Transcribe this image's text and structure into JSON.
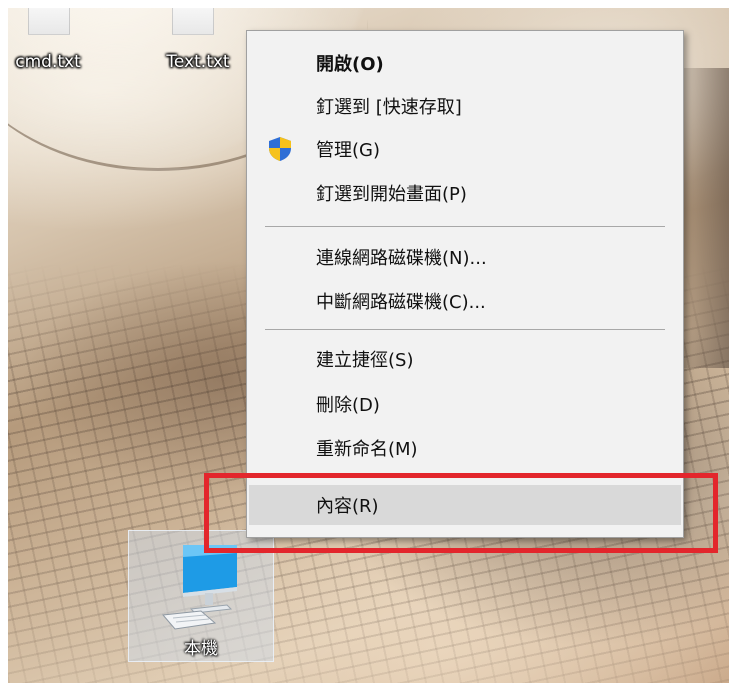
{
  "desktop": {
    "files": [
      {
        "label": "cmd.txt",
        "icon": "text-file-icon"
      },
      {
        "label": "Text.txt",
        "icon": "text-file-icon"
      }
    ],
    "this_pc": {
      "label": "本機",
      "icon": "computer-monitor-icon"
    }
  },
  "context_menu": {
    "items": [
      {
        "label": "開啟(O)",
        "bold": true
      },
      {
        "label": "釘選到 [快速存取]"
      },
      {
        "label": "管理(G)",
        "icon": "uac-shield-icon"
      },
      {
        "label": "釘選到開始畫面(P)"
      },
      {
        "label": "連線網路磁碟機(N)..."
      },
      {
        "label": "中斷網路磁碟機(C)..."
      },
      {
        "label": "建立捷徑(S)"
      },
      {
        "label": "刪除(D)"
      },
      {
        "label": "重新命名(M)"
      },
      {
        "label": "內容(R)",
        "highlighted": true
      }
    ]
  },
  "annotation": {
    "color": "#e3262c",
    "target": "內容(R)"
  },
  "colors": {
    "menu_background": "#f2f2f2",
    "menu_hover": "#d9d9d9",
    "shield_blue": "#2f6fd6",
    "shield_yellow": "#f6c21c"
  }
}
